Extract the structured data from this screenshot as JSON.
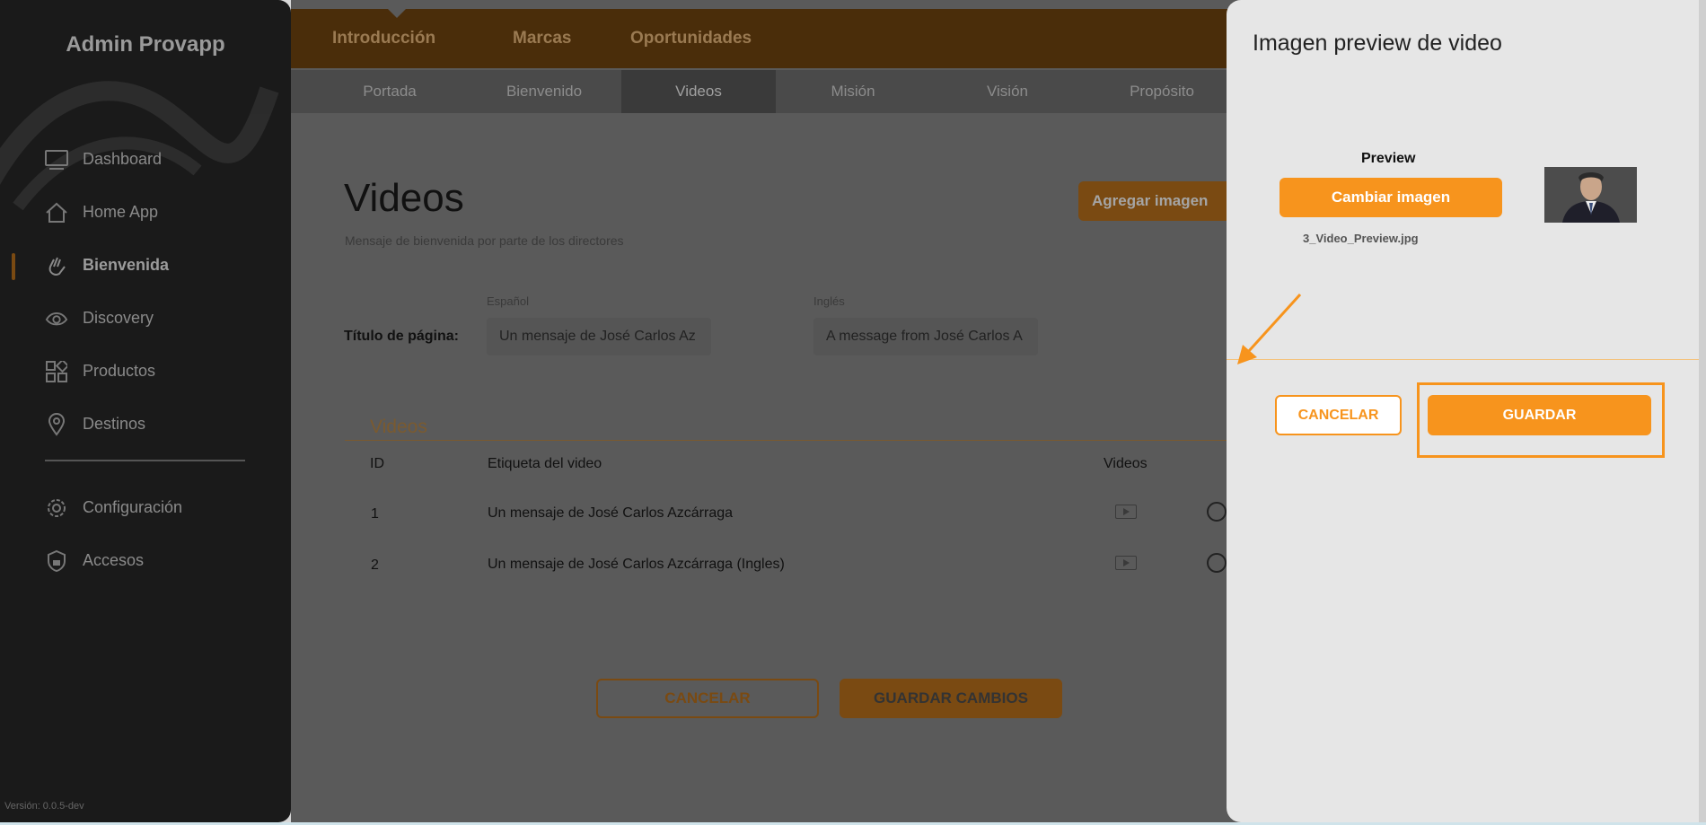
{
  "sidebar": {
    "brand": "Admin Provapp",
    "items": [
      {
        "label": "Dashboard",
        "icon": "monitor-icon"
      },
      {
        "label": "Home App",
        "icon": "home-icon"
      },
      {
        "label": "Bienvenida",
        "icon": "wave-hand-icon",
        "active": true
      },
      {
        "label": "Discovery",
        "icon": "eye-icon"
      },
      {
        "label": "Productos",
        "icon": "grid-icon"
      },
      {
        "label": "Destinos",
        "icon": "map-pin-icon"
      }
    ],
    "items2": [
      {
        "label": "Configuración",
        "icon": "gear-icon"
      },
      {
        "label": "Accesos",
        "icon": "shield-icon"
      }
    ],
    "version": "Versión: 0.0.5-dev"
  },
  "topnav": {
    "tabs": [
      "Introducción",
      "Marcas",
      "Oportunidades"
    ]
  },
  "subnav": {
    "tabs": [
      "Portada",
      "Bienvenido",
      "Videos",
      "Misión",
      "Visión",
      "Propósito"
    ],
    "active": "Videos"
  },
  "main": {
    "title": "Videos",
    "subtitle": "Mensaje de bienvenida por parte de los directores",
    "add_button": "Agregar imagen",
    "label_es": "Español",
    "label_en": "Inglés",
    "page_title_label": "Título de página:",
    "title_es": "Un mensaje de José Carlos Az",
    "title_en": "A message from José Carlos A",
    "section": "Videos",
    "table": {
      "headers": [
        "ID",
        "Etiqueta del video",
        "Videos"
      ],
      "rows": [
        {
          "id": "1",
          "label": "Un mensaje de José Carlos Azcárraga"
        },
        {
          "id": "2",
          "label": "Un mensaje de José Carlos Azcárraga (Ingles)"
        }
      ]
    },
    "cancel_button": "CANCELAR",
    "save_button": "GUARDAR CAMBIOS"
  },
  "modal": {
    "title": "Imagen preview de video",
    "preview_label": "Preview",
    "change_button": "Cambiar imagen",
    "filename": "3_Video_Preview.jpg",
    "cancel_button": "CANCELAR",
    "save_button": "GUARDAR"
  },
  "colors": {
    "accent": "#f7941d",
    "sidebar_bg": "#1a1a1a",
    "panel_bg": "#e6e6e6"
  }
}
